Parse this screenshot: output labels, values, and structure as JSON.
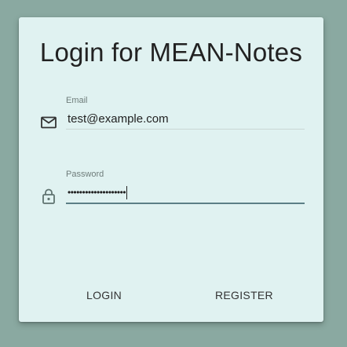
{
  "login_form": {
    "title": "Login for MEAN-Notes",
    "email": {
      "label": "Email",
      "value": "test@example.com",
      "icon": "mail-icon"
    },
    "password": {
      "label": "Password",
      "masked_value": "••••••••••••••••••••",
      "icon": "lock-icon"
    },
    "buttons": {
      "login": "LOGIN",
      "register": "REGISTER"
    }
  },
  "colors": {
    "background": "#8aa9a1",
    "card": "#e0f2f1",
    "focus_underline": "#5c7f86"
  }
}
